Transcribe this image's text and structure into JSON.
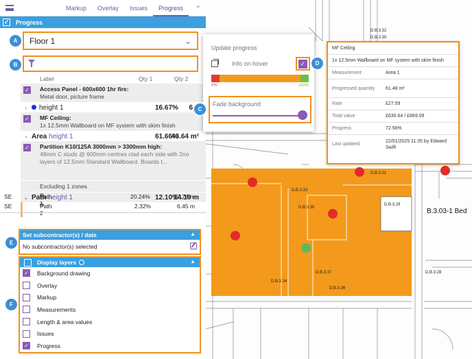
{
  "topbar": {
    "tabs": [
      "Markup",
      "Overlay",
      "Issues",
      "Progress"
    ],
    "active_tab": "Progress"
  },
  "panel": {
    "header": "Progress",
    "floor": "Floor 1",
    "columns": {
      "label": "Label",
      "qty1": "Qty 1",
      "qty2": "Qty 2"
    }
  },
  "items": [
    {
      "title": "Access Panel - 600x600 1hr fire:",
      "desc": "Metal door, picture frame",
      "sub": {
        "label": "height 1",
        "qty1": "16.67%",
        "qty2": "6 u"
      }
    },
    {
      "title": "MF Ceiling:",
      "desc": "1x 12.5mm Wallboard on MF system with skim finish",
      "sub": {
        "label_bold": "Area",
        "label": "height 1",
        "qty1": "61.66%",
        "qty2": "43.64 m²"
      }
    },
    {
      "title": "Partition K10/125A 3000mm > 3300mm high:",
      "desc": "48mm C studs @ 600mm centres clad each side with 2no layers of 12.5mm Standard Wallboard. Boards t...",
      "note": "Excluding 1 zones",
      "sub": {
        "label_bold": "Path",
        "label": "height 1",
        "qty1": "12.10%",
        "qty2": "14.19 m"
      },
      "paths": [
        {
          "code": "SE",
          "label": "Path 1",
          "qty1": "20.24%",
          "qty2": "7.74 m"
        },
        {
          "code": "SE",
          "label": "Path 2",
          "qty1": "2.32%",
          "qty2": "6.45 m"
        }
      ]
    }
  ],
  "subcontractor": {
    "header": "Set subcontractor(s) / date",
    "text": "No subcontractor(s) selected"
  },
  "layers": {
    "header": "Display layers",
    "items": [
      {
        "label": "Background drawing",
        "checked": true
      },
      {
        "label": "Overlay",
        "checked": false
      },
      {
        "label": "Markup",
        "checked": false
      },
      {
        "label": "Measurements",
        "checked": false
      },
      {
        "label": "Length & area values",
        "checked": false
      },
      {
        "label": "Issues",
        "checked": false
      },
      {
        "label": "Progress",
        "checked": true
      }
    ]
  },
  "popover": {
    "title": "Update progress",
    "info_on_hover": "Info on hover",
    "range_min": "0%",
    "range_max": "100%",
    "fade_label": "Fade background",
    "fade_value": 0.96
  },
  "card": {
    "title": "MF Ceiling",
    "desc": "1x 12.5mm Wallboard on MF system with skim finish",
    "rows": [
      {
        "k": "Measurement",
        "v": "Area 1"
      },
      {
        "k": "Progressed quantity",
        "v": "61.48 m²"
      },
      {
        "k": "Rate",
        "v": "£27.59"
      },
      {
        "k": "Total value",
        "v": "£630.64 / £869.09"
      },
      {
        "k": "Progress",
        "v": "72.56%"
      },
      {
        "k": "Last updated",
        "v": "22/01/2025 11:35 by Edward Swift"
      }
    ]
  },
  "badges": [
    "A",
    "B",
    "C",
    "D",
    "E",
    "F"
  ],
  "drawing": {
    "room_label_big": "B.3.03-1 Bed",
    "room_labels": [
      "D.B.3.32",
      "D.B.3.30",
      "D.B.3.31",
      "D.B.3.29",
      "D.B.3.33",
      "D.B.3.28",
      "D.B.3.34",
      "D.B.3.37",
      "D.B.3.35",
      "D.B.3.36"
    ],
    "fill_color": "#f39a1c",
    "marker_red": "#e52a2a",
    "marker_green": "#5cb85c"
  }
}
